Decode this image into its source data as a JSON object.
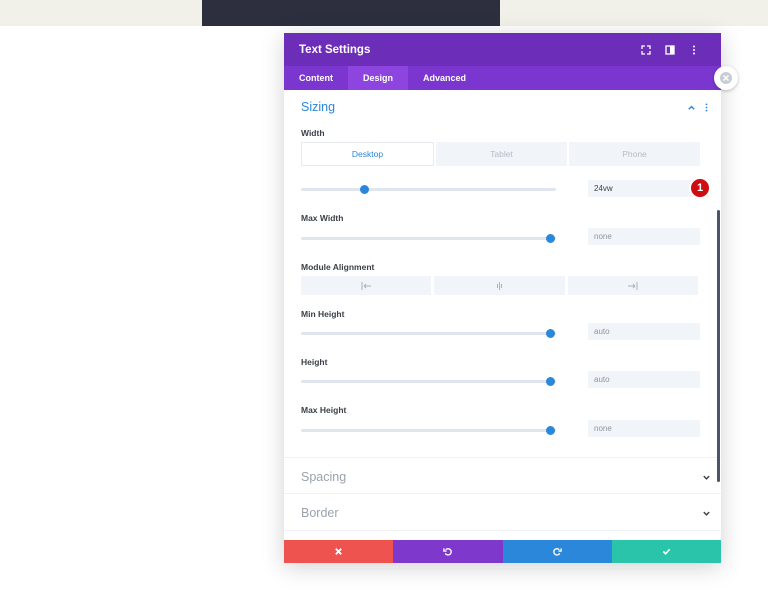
{
  "colors": {
    "header_bg": "#6c2eb9",
    "tabs_bg": "#7b36cf",
    "accent_blue": "#2b87da",
    "cancel": "#ef5350",
    "undo": "#7f38cc",
    "redo": "#2b87da",
    "save": "#29c4a9",
    "badge": "#cc0e12"
  },
  "modal": {
    "title": "Text Settings",
    "header_icons": [
      "fullscreen-icon",
      "split-view-icon",
      "more-options-icon"
    ],
    "tabs": [
      {
        "label": "Content",
        "active": false
      },
      {
        "label": "Design",
        "active": true
      },
      {
        "label": "Advanced",
        "active": false
      }
    ]
  },
  "sizing": {
    "title": "Sizing",
    "width": {
      "label": "Width",
      "device_tabs": [
        "Desktop",
        "Tablet",
        "Phone"
      ],
      "active_device": "Desktop",
      "value": "24vw",
      "slider_level": 0.25
    },
    "max_width": {
      "label": "Max Width",
      "value": "none",
      "slider_level": 0.98
    },
    "module_alignment": {
      "label": "Module Alignment",
      "options": [
        "align-left-icon",
        "align-center-icon",
        "align-right-icon"
      ]
    },
    "min_height": {
      "label": "Min Height",
      "value": "auto",
      "slider_level": 0.98
    },
    "height": {
      "label": "Height",
      "value": "auto",
      "slider_level": 0.98
    },
    "max_height": {
      "label": "Max Height",
      "value": "none",
      "slider_level": 0.98
    }
  },
  "annotation": {
    "badge": "1"
  },
  "sections": {
    "spacing": "Spacing",
    "border": "Border"
  },
  "footer": {
    "buttons": [
      "cancel-icon",
      "undo-icon",
      "redo-icon",
      "save-check-icon"
    ]
  }
}
